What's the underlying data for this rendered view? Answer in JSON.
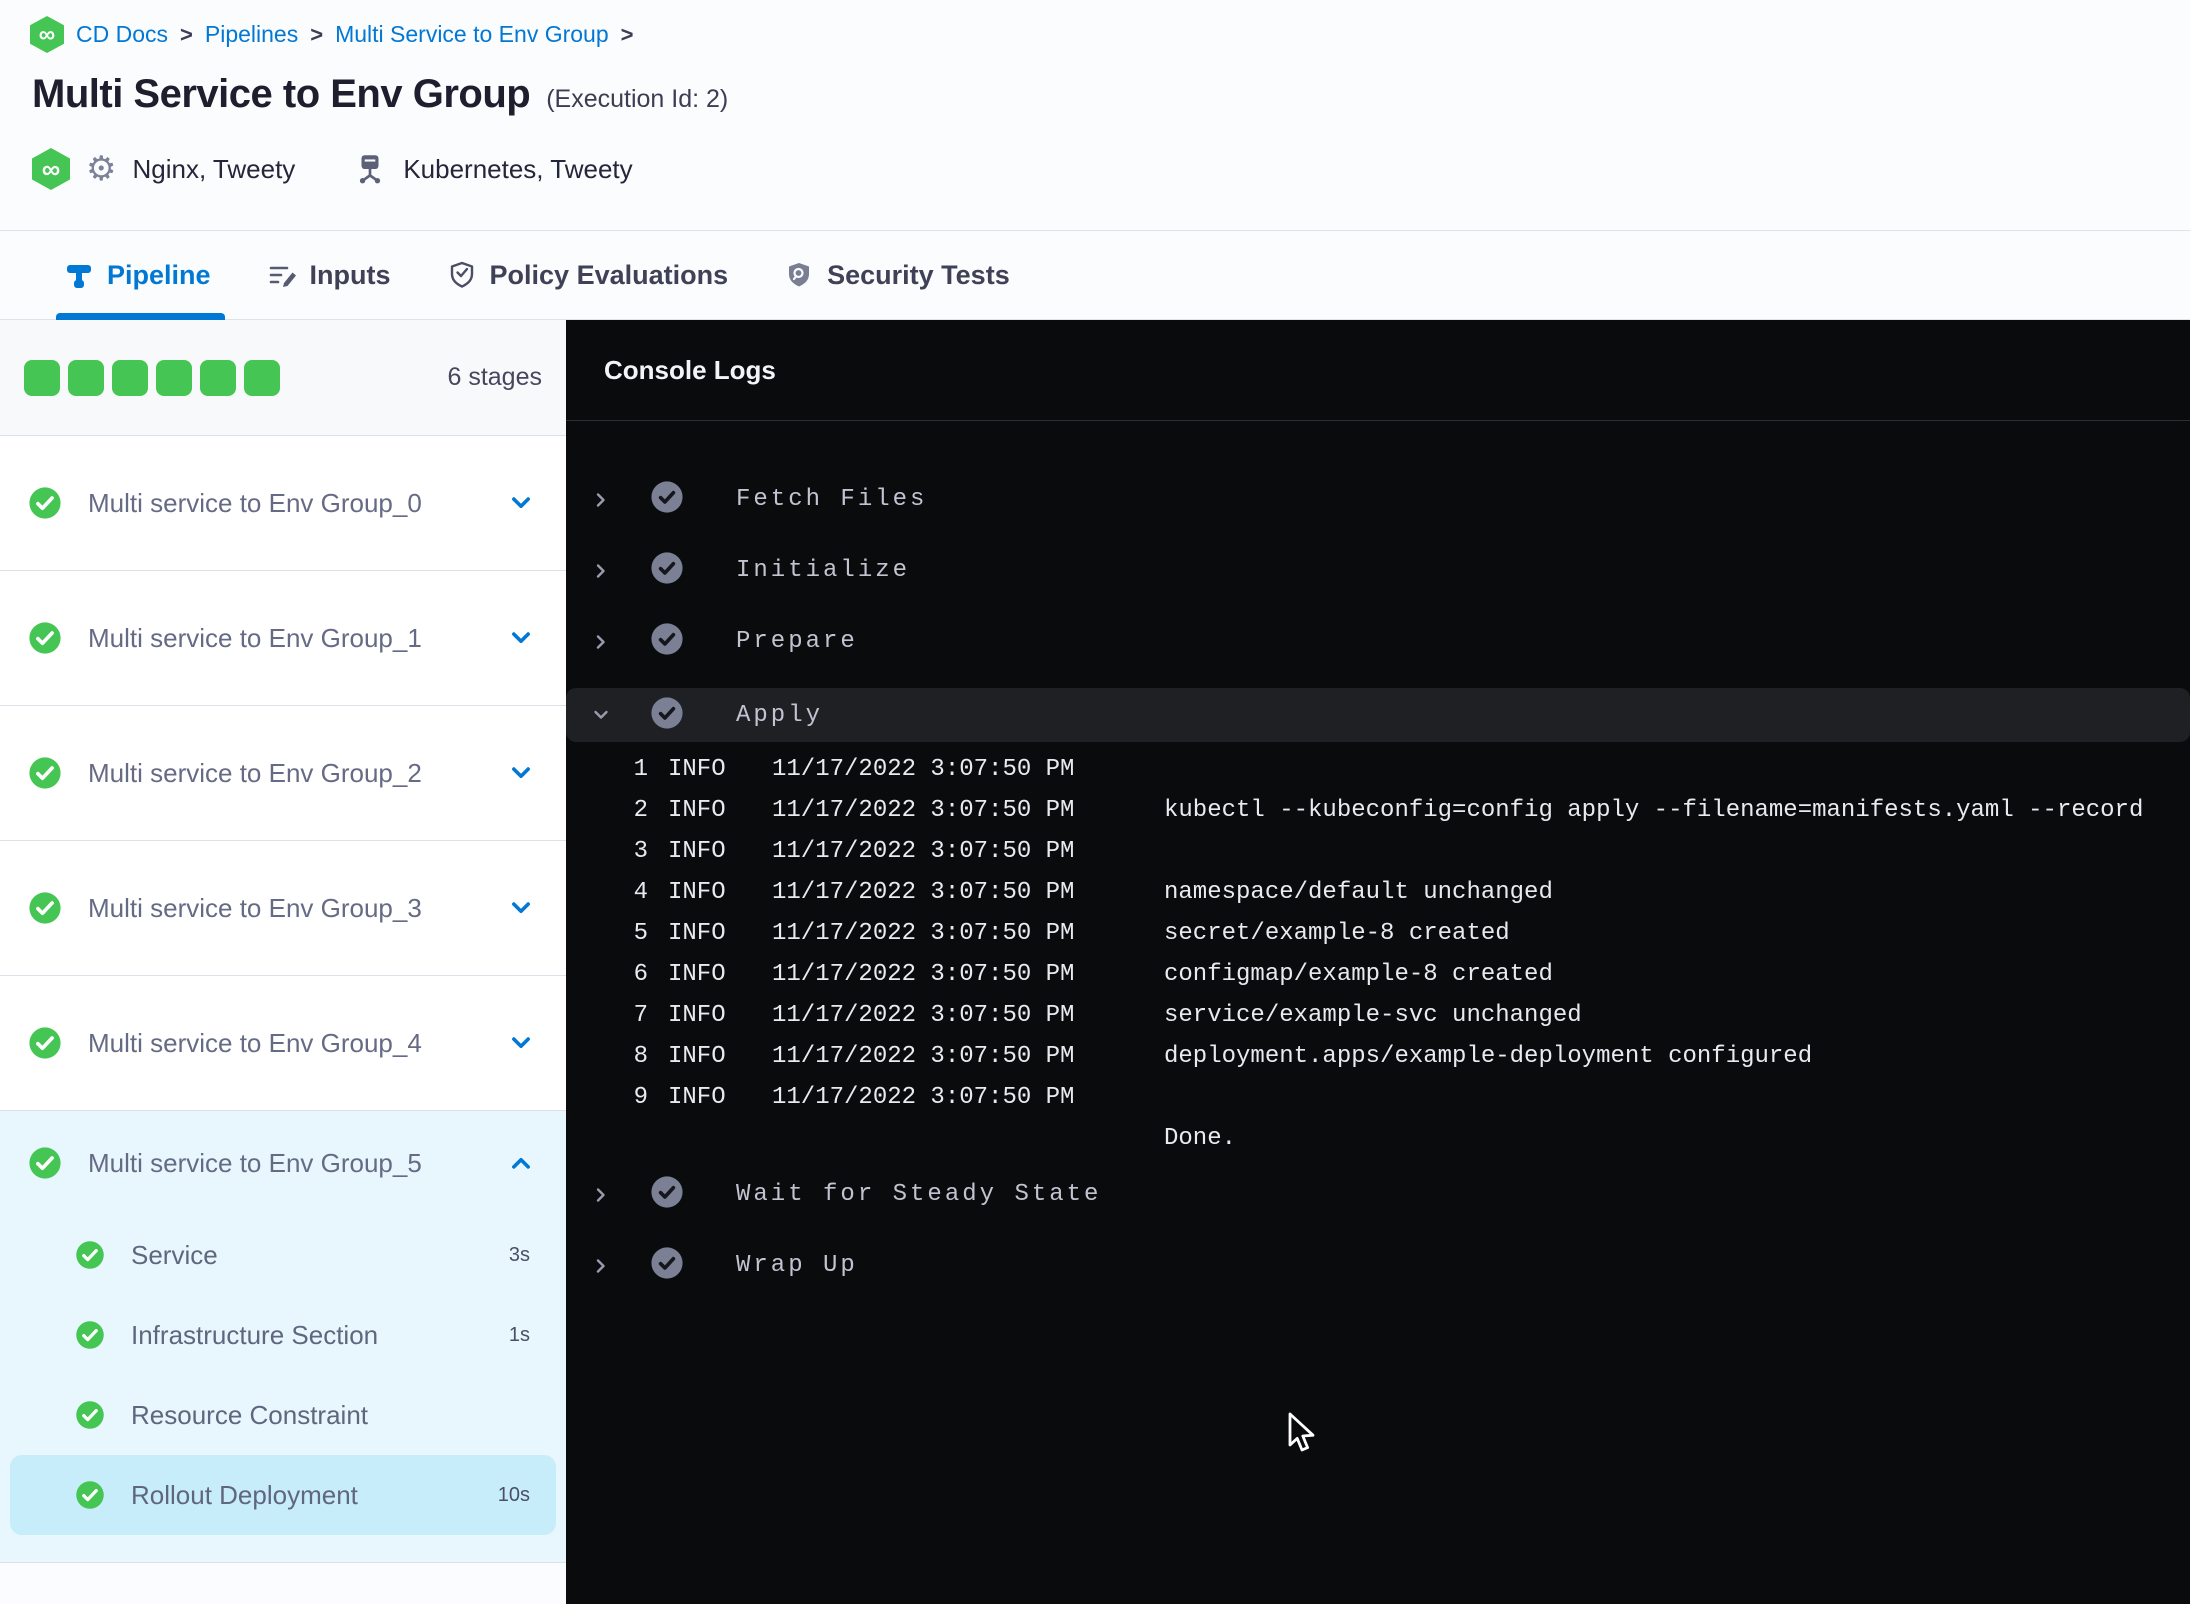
{
  "colors": {
    "accent_blue": "#0278d5",
    "success_green": "#45c553",
    "console_bg": "#0a0b0d",
    "selected_step_bg": "#c7edfb",
    "expanded_group_bg": "#e7f7fd"
  },
  "icons": {
    "logo_glyph": "∞",
    "gear_glyph": "⚙",
    "breadcrumb_separator": ">"
  },
  "breadcrumb": {
    "items": [
      "CD Docs",
      "Pipelines",
      "Multi Service to Env Group"
    ]
  },
  "header": {
    "title": "Multi Service to Env Group",
    "execution_id": "(Execution Id: 2)",
    "services": "Nginx, Tweety",
    "environments": "Kubernetes, Tweety"
  },
  "tabs": [
    {
      "label": "Pipeline",
      "active": true
    },
    {
      "label": "Inputs",
      "active": false
    },
    {
      "label": "Policy Evaluations",
      "active": false
    },
    {
      "label": "Security Tests",
      "active": false
    }
  ],
  "sidebar": {
    "stage_count_label": "6 stages",
    "stages": [
      {
        "label": "Multi service to Env Group_0",
        "expanded": false
      },
      {
        "label": "Multi service to Env Group_1",
        "expanded": false
      },
      {
        "label": "Multi service to Env Group_2",
        "expanded": false
      },
      {
        "label": "Multi service to Env Group_3",
        "expanded": false
      },
      {
        "label": "Multi service to Env Group_4",
        "expanded": false
      },
      {
        "label": "Multi service to Env Group_5",
        "expanded": true,
        "steps": [
          {
            "label": "Service",
            "duration": "3s",
            "selected": false
          },
          {
            "label": "Infrastructure Section",
            "duration": "1s",
            "selected": false
          },
          {
            "label": "Resource Constraint",
            "duration": "",
            "selected": false
          },
          {
            "label": "Rollout Deployment",
            "duration": "10s",
            "selected": true
          }
        ]
      }
    ]
  },
  "console": {
    "title": "Console Logs",
    "sections": [
      {
        "label": "Fetch Files",
        "expanded": false
      },
      {
        "label": "Initialize",
        "expanded": false
      },
      {
        "label": "Prepare",
        "expanded": false
      },
      {
        "label": "Apply",
        "expanded": true,
        "logs": [
          {
            "num": "1",
            "level": "INFO",
            "time": "11/17/2022 3:07:50 PM",
            "message": ""
          },
          {
            "num": "2",
            "level": "INFO",
            "time": "11/17/2022 3:07:50 PM",
            "message": "kubectl --kubeconfig=config apply --filename=manifests.yaml --record"
          },
          {
            "num": "3",
            "level": "INFO",
            "time": "11/17/2022 3:07:50 PM",
            "message": ""
          },
          {
            "num": "4",
            "level": "INFO",
            "time": "11/17/2022 3:07:50 PM",
            "message": "namespace/default unchanged"
          },
          {
            "num": "5",
            "level": "INFO",
            "time": "11/17/2022 3:07:50 PM",
            "message": "secret/example-8 created"
          },
          {
            "num": "6",
            "level": "INFO",
            "time": "11/17/2022 3:07:50 PM",
            "message": "configmap/example-8 created"
          },
          {
            "num": "7",
            "level": "INFO",
            "time": "11/17/2022 3:07:50 PM",
            "message": "service/example-svc unchanged"
          },
          {
            "num": "8",
            "level": "INFO",
            "time": "11/17/2022 3:07:50 PM",
            "message": "deployment.apps/example-deployment configured"
          },
          {
            "num": "9",
            "level": "INFO",
            "time": "11/17/2022 3:07:50 PM",
            "message": ""
          },
          {
            "num": "",
            "level": "",
            "time": "",
            "message": "Done."
          }
        ]
      },
      {
        "label": "Wait for Steady State",
        "expanded": false
      },
      {
        "label": "Wrap Up",
        "expanded": false
      }
    ]
  }
}
